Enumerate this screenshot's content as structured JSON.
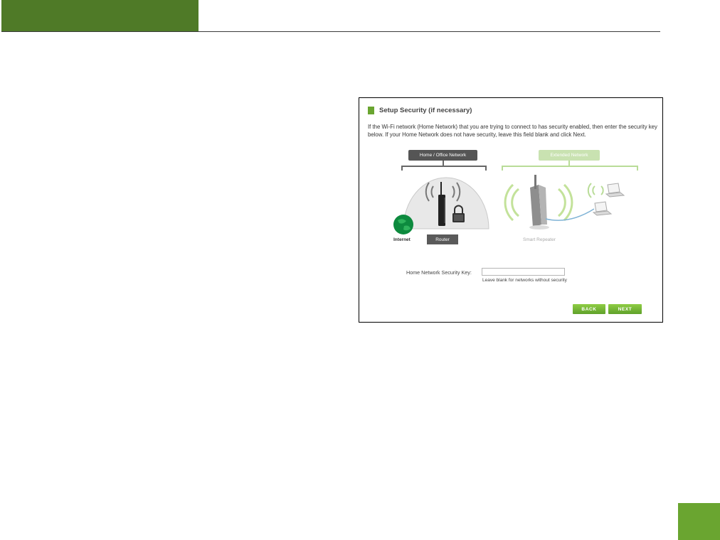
{
  "setup": {
    "title": "Setup Security (if necessary)",
    "intro": "If the Wi-Fi network (Home Network) that you are trying to connect to has security enabled, then enter the security key below. If your Home Network does not have security, leave this field blank and click Next.",
    "home_network_label": "Home / Office Network",
    "extended_network_label": "Extended Network",
    "internet_label": "Internet",
    "router_label": "Router",
    "repeater_label": "Smart Repeater",
    "key_label": "Home Network Security Key:",
    "key_value": "",
    "key_hint": "Leave blank for networks without security",
    "back_label": "BACK",
    "next_label": "NEXT"
  },
  "colors": {
    "header_green": "#4f7a27",
    "accent_green": "#6aa530",
    "light_green": "#c9e2b1"
  }
}
